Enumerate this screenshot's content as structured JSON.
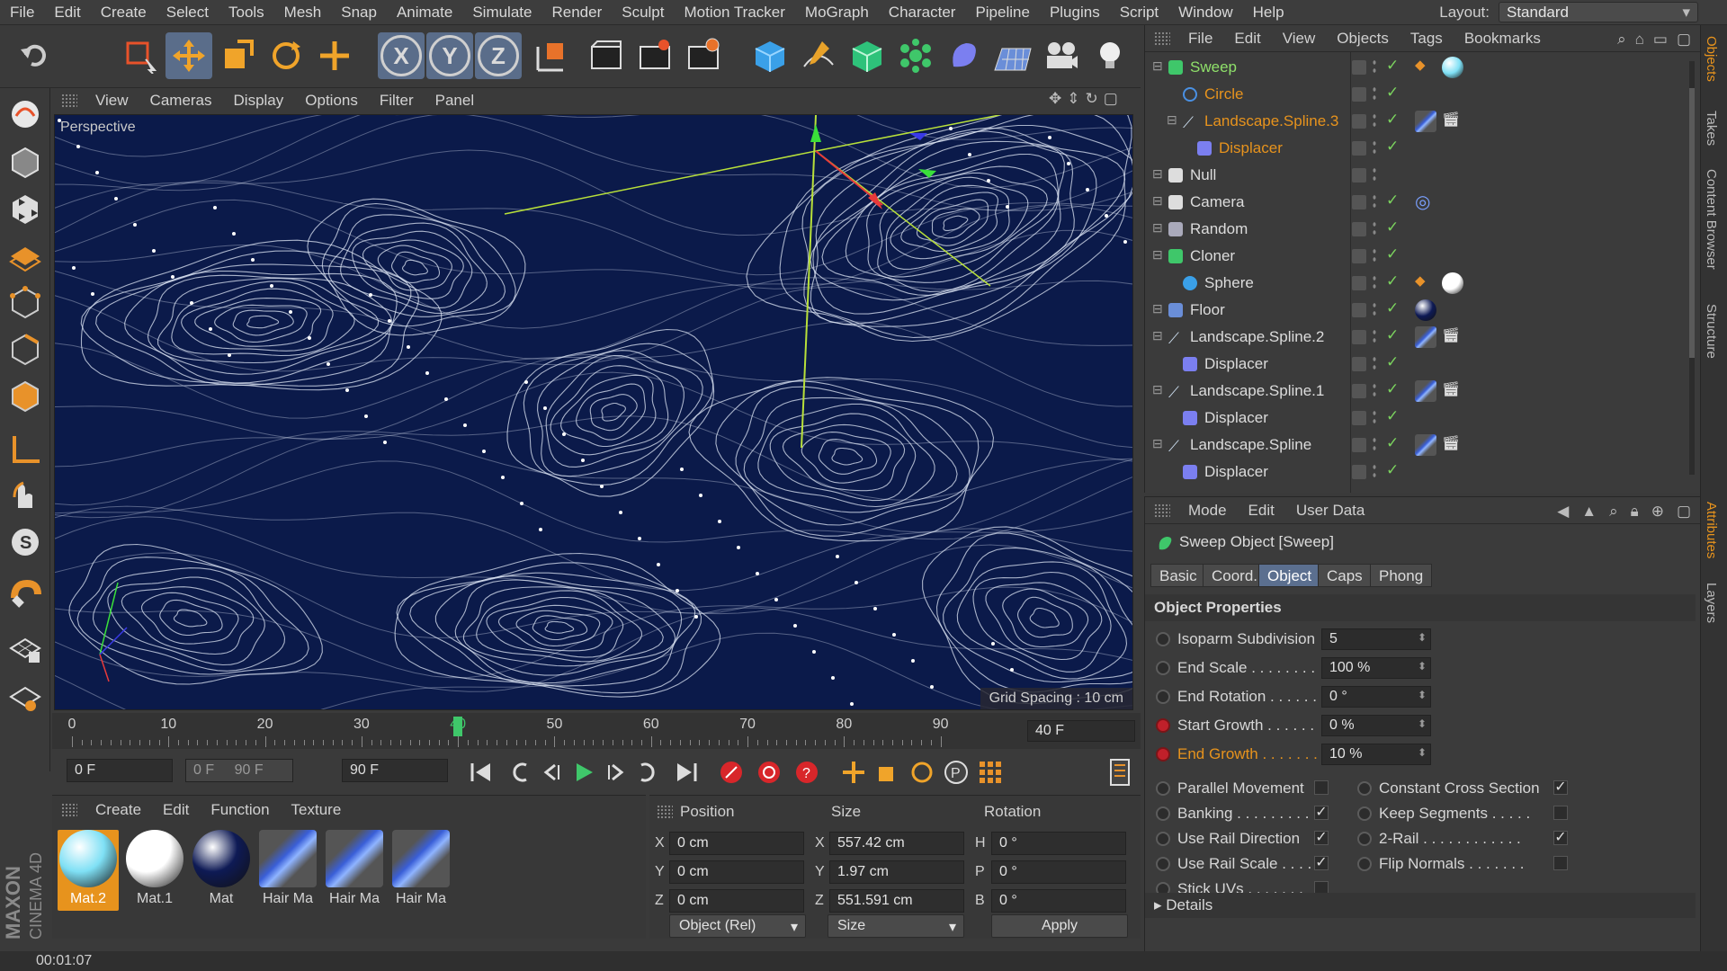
{
  "menubar": {
    "items": [
      "File",
      "Edit",
      "Create",
      "Select",
      "Tools",
      "Mesh",
      "Snap",
      "Animate",
      "Simulate",
      "Render",
      "Sculpt",
      "Motion Tracker",
      "MoGraph",
      "Character",
      "Pipeline",
      "Plugins",
      "Script",
      "Window",
      "Help"
    ],
    "layout_label": "Layout:",
    "layout_value": "Standard"
  },
  "toolbar": {
    "axis_x": "X",
    "axis_y": "Y",
    "axis_z": "Z"
  },
  "viewport": {
    "menu": [
      "View",
      "Cameras",
      "Display",
      "Options",
      "Filter",
      "Panel"
    ],
    "label": "Perspective",
    "grid_spacing": "Grid Spacing : 10 cm",
    "background_color": "#0b1a4a",
    "contour_color": "#dfe7f5"
  },
  "timeline": {
    "ticks": [
      "0",
      "10",
      "20",
      "30",
      "40",
      "50",
      "60",
      "70",
      "80",
      "90"
    ],
    "current_frame": 40,
    "current_frame_field": "40 F",
    "start_field": "0 F",
    "range_min": "0 F",
    "range_max": "90 F",
    "end_field": "90 F"
  },
  "materials": {
    "menu": [
      "Create",
      "Edit",
      "Function",
      "Texture"
    ],
    "items": [
      {
        "label": "Mat.2",
        "color": "#7fe0f5",
        "active": true
      },
      {
        "label": "Mat.1",
        "color": "#ffffff"
      },
      {
        "label": "Mat",
        "color": "#0e1a55"
      },
      {
        "label": "Hair Ma",
        "color": "#3a5fd8"
      },
      {
        "label": "Hair Ma",
        "color": "#3a5fd8"
      },
      {
        "label": "Hair Ma",
        "color": "#3a5fd8"
      }
    ]
  },
  "coords": {
    "headers": {
      "position": "Position",
      "size": "Size",
      "rotation": "Rotation"
    },
    "rows": [
      {
        "pl": "X",
        "pv": "0 cm",
        "sl": "X",
        "sv": "557.42 cm",
        "rl": "H",
        "rv": "0 °"
      },
      {
        "pl": "Y",
        "pv": "0 cm",
        "sl": "Y",
        "sv": "1.97 cm",
        "rl": "P",
        "rv": "0 °"
      },
      {
        "pl": "Z",
        "pv": "0 cm",
        "sl": "Z",
        "sv": "551.591 cm",
        "rl": "B",
        "rv": "0 °"
      }
    ],
    "mode_dropdown": "Object (Rel)",
    "size_dropdown": "Size",
    "apply": "Apply"
  },
  "status": {
    "time": "00:01:07"
  },
  "maxon": {
    "brand": "MAXON",
    "product": "CINEMA 4D"
  },
  "object_manager": {
    "menu": [
      "File",
      "Edit",
      "View",
      "Objects",
      "Tags",
      "Bookmarks"
    ],
    "objects": [
      {
        "name": "Sweep",
        "indent": 0,
        "style": "green",
        "tag": "#7fe0f5"
      },
      {
        "name": "Circle",
        "indent": 1,
        "style": "orange"
      },
      {
        "name": "Landscape.Spline.3",
        "indent": 1,
        "style": "orange",
        "tag": "hair"
      },
      {
        "name": "Displacer",
        "indent": 2,
        "style": "orange"
      },
      {
        "name": "Null",
        "indent": 0,
        "style": ""
      },
      {
        "name": "Camera",
        "indent": 0,
        "style": "",
        "tag": "camera"
      },
      {
        "name": "Random",
        "indent": 0,
        "style": ""
      },
      {
        "name": "Cloner",
        "indent": 0,
        "style": ""
      },
      {
        "name": "Sphere",
        "indent": 1,
        "style": "",
        "tag": "#ffffff"
      },
      {
        "name": "Floor",
        "indent": 0,
        "style": "",
        "tag": "#0e1a55"
      },
      {
        "name": "Landscape.Spline.2",
        "indent": 0,
        "style": "",
        "tag": "hair"
      },
      {
        "name": "Displacer",
        "indent": 1,
        "style": ""
      },
      {
        "name": "Landscape.Spline.1",
        "indent": 0,
        "style": "",
        "tag": "hair"
      },
      {
        "name": "Displacer",
        "indent": 1,
        "style": ""
      },
      {
        "name": "Landscape.Spline",
        "indent": 0,
        "style": "",
        "tag": "hair"
      },
      {
        "name": "Displacer",
        "indent": 1,
        "style": ""
      }
    ]
  },
  "attributes": {
    "menu": [
      "Mode",
      "Edit",
      "User Data"
    ],
    "title": "Sweep Object [Sweep]",
    "tabs": [
      "Basic",
      "Coord.",
      "Object",
      "Caps",
      "Phong"
    ],
    "active_tab": "Object",
    "section": "Object Properties",
    "props": [
      {
        "label": "Isoparm Subdivision",
        "value": "5"
      },
      {
        "label": "End Scale . . . . . . . .",
        "value": "100 %"
      },
      {
        "label": "End Rotation . . . . . .",
        "value": "0 °"
      },
      {
        "label": "Start Growth . . . . . .",
        "value": "0 %",
        "keyed": true
      },
      {
        "label": "End Growth . . . . . . .",
        "value": "10 %",
        "keyed": true,
        "highlight": true
      }
    ],
    "checks_left": [
      {
        "label": "Parallel Movement",
        "checked": false
      },
      {
        "label": "Banking . . . . . . . . .",
        "checked": true
      },
      {
        "label": "Use Rail Direction",
        "checked": true
      },
      {
        "label": "Use Rail Scale . . . .",
        "checked": true
      },
      {
        "label": "Stick UVs . . . . . . .",
        "checked": false
      }
    ],
    "checks_right": [
      {
        "label": "Constant Cross Section",
        "checked": true
      },
      {
        "label": "Keep Segments . . . . .",
        "checked": false
      },
      {
        "label": "2-Rail . . . . . . . . . . . .",
        "checked": true
      },
      {
        "label": "Flip Normals . . . . . . .",
        "checked": false
      }
    ],
    "details": "Details"
  },
  "right_tabs": [
    "Objects",
    "Takes",
    "Content Browser",
    "Structure",
    "Attributes",
    "Layers"
  ]
}
